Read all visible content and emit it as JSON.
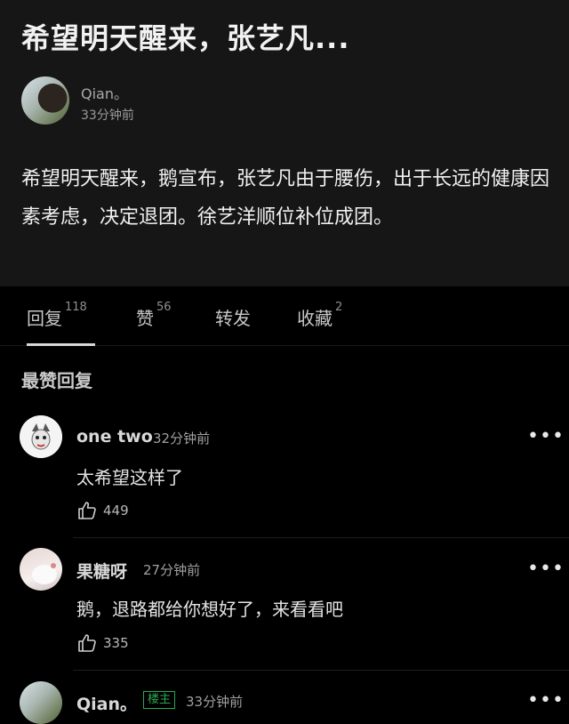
{
  "post": {
    "title": "希望明天醒来，张艺凡...",
    "author": "Qian。",
    "time": "33分钟前",
    "body": "希望明天醒来，鹅宣布，张艺凡由于腰伤，出于长远的健康因素考虑，决定退团。徐艺洋顺位补位成团。"
  },
  "tabs": [
    {
      "label": "回复",
      "count": "118",
      "active": true
    },
    {
      "label": "赞",
      "count": "56",
      "active": false
    },
    {
      "label": "转发",
      "count": "",
      "active": false
    },
    {
      "label": "收藏",
      "count": "2",
      "active": false
    }
  ],
  "section_title": "最赞回复",
  "comments": [
    {
      "name": "one two",
      "time": "32分钟前",
      "text": "太希望这样了",
      "likes": "449",
      "avatar_icon": "cartoon-mask-avatar",
      "more": "•••"
    },
    {
      "name": "果糖呀",
      "time": "27分钟前",
      "text": "鹅，退路都给你想好了，来看看吧",
      "likes": "335",
      "avatar_icon": "kitten-avatar",
      "more": "•••"
    },
    {
      "name": "Qian。",
      "badge": "楼主",
      "time": "33分钟前",
      "more": "•••"
    }
  ],
  "colors": {
    "accent_badge": "#2aa84d",
    "background": "#000000",
    "post_bg": "#161616"
  }
}
